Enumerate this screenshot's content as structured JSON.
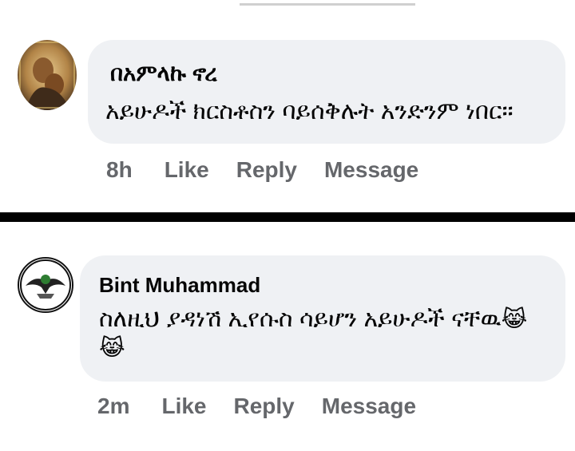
{
  "comments": [
    {
      "author": "በአምላኩ ኖረ",
      "text": "አይሁዶች ክርስቶስን ባይሰቅሉት አንድንም ነበር።",
      "time": "8h",
      "like_label": "Like",
      "reply_label": "Reply",
      "message_label": "Message",
      "avatar_icon": "icon-painting-avatar"
    },
    {
      "author": "Bint Muhammad",
      "text": "ስለዚህ ያዳነሽ ኢየሱስ ሳይሆን አይሁዶች ናቸዉ",
      "emoji": "😹",
      "emoji2": "😹",
      "time": "2m",
      "like_label": "Like",
      "reply_label": "Reply",
      "message_label": "Message",
      "avatar_icon": "eagle-logo-avatar"
    }
  ],
  "colors": {
    "bubble": "#eff1f4",
    "meta": "#65676b",
    "divider": "#000000"
  }
}
